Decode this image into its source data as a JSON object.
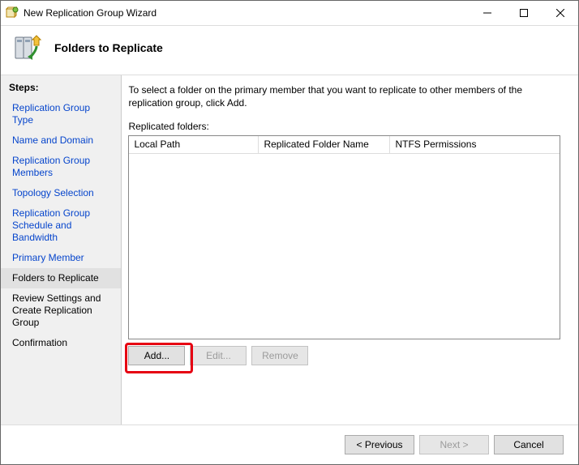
{
  "window": {
    "title": "New Replication Group Wizard"
  },
  "header": {
    "title": "Folders to Replicate"
  },
  "sidebar": {
    "title": "Steps:",
    "items": [
      {
        "label": "Replication Group Type",
        "state": "past"
      },
      {
        "label": "Name and Domain",
        "state": "past"
      },
      {
        "label": "Replication Group Members",
        "state": "past"
      },
      {
        "label": "Topology Selection",
        "state": "past"
      },
      {
        "label": "Replication Group Schedule and Bandwidth",
        "state": "past"
      },
      {
        "label": "Primary Member",
        "state": "past"
      },
      {
        "label": "Folders to Replicate",
        "state": "current"
      },
      {
        "label": "Review Settings and Create Replication Group",
        "state": "future"
      },
      {
        "label": "Confirmation",
        "state": "future"
      }
    ]
  },
  "content": {
    "intro": "To select a folder on the primary member that you want to replicate to other members of the replication group, click Add.",
    "list_label": "Replicated folders:",
    "columns": {
      "c1": "Local Path",
      "c2": "Replicated Folder Name",
      "c3": "NTFS Permissions"
    },
    "buttons": {
      "add": "Add...",
      "edit": "Edit...",
      "remove": "Remove"
    }
  },
  "footer": {
    "previous": "< Previous",
    "next": "Next >",
    "cancel": "Cancel"
  }
}
